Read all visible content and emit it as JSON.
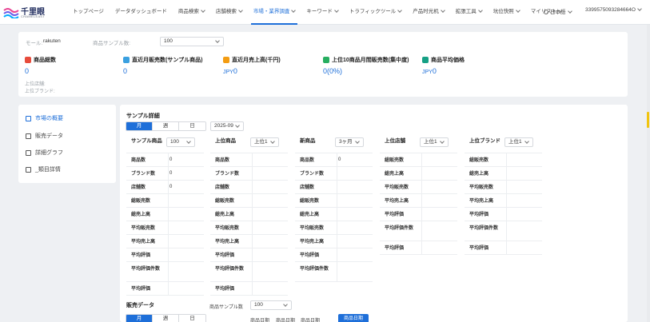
{
  "brand": {
    "name": "千里眼",
    "subtitle": "CHAMELEAST"
  },
  "nav": {
    "items": [
      {
        "label": "トップページ",
        "dropdown": false,
        "active": false
      },
      {
        "label": "データダッシュボード",
        "dropdown": false,
        "active": false
      },
      {
        "label": "商品検索",
        "dropdown": true,
        "active": false
      },
      {
        "label": "店舗検索",
        "dropdown": true,
        "active": false
      },
      {
        "label": "市場・業界調査",
        "dropdown": true,
        "active": true
      },
      {
        "label": "キーワード",
        "dropdown": true,
        "active": false
      },
      {
        "label": "トラフィックツール",
        "dropdown": true,
        "active": false
      },
      {
        "label": "产品时光机",
        "dropdown": true,
        "active": false
      },
      {
        "label": "拡張工具",
        "dropdown": true,
        "active": false
      },
      {
        "label": "坑位快照",
        "dropdown": true,
        "active": false
      },
      {
        "label": "マイリスト",
        "dropdown": true,
        "active": false
      }
    ],
    "language": "日本語",
    "user": "3399575093284664O"
  },
  "summary": {
    "mall_label": "モール:",
    "mall_value": "rakuten",
    "sample_label": "商品サンプル数:",
    "sample_value": "100",
    "metrics": [
      {
        "icon": "product-count-icon",
        "color": "#e74c3c",
        "title": "商品総数",
        "value": "0",
        "currency": ""
      },
      {
        "icon": "monthly-sales-icon",
        "color": "#3aa0e0",
        "title": "直近月販売数(サンプル商品)",
        "value": "0",
        "currency": ""
      },
      {
        "icon": "monthly-revenue-icon",
        "color": "#f39c12",
        "title": "直近月売上高(千円)",
        "value": "0",
        "currency": "JPY"
      },
      {
        "icon": "top10-share-icon",
        "color": "#27ae60",
        "title": "上位10商品月間販売数(集中度)",
        "value": "0(0%)",
        "currency": ""
      },
      {
        "icon": "average-price-icon",
        "color": "#16a085",
        "title": "商品平均価格",
        "value": "0",
        "currency": "JPY"
      }
    ],
    "top_shop_label": "上位店舗:",
    "top_brand_label": "上位ブランド:"
  },
  "sidebar": {
    "items": [
      {
        "label": "市場の概要",
        "icon": "market-overview-icon",
        "active": true
      },
      {
        "label": "販売データ",
        "icon": "sales-data-icon",
        "active": false
      },
      {
        "label": "詳細グラフ",
        "icon": "detail-graph-icon",
        "active": false
      },
      {
        "label": "_類目詳情",
        "icon": "category-detail-icon",
        "active": false
      }
    ]
  },
  "sample_detail": {
    "title": "サンプル詳細",
    "tabs": [
      "月",
      "週",
      "日"
    ],
    "active_tab": 0,
    "month_value": "2025-09",
    "groups": [
      {
        "header": "サンプル商品",
        "select": "100",
        "rows": [
          {
            "k": "商品数",
            "v": "0"
          },
          {
            "k": "ブランド数",
            "v": "0"
          },
          {
            "k": "店舗数",
            "v": "0"
          },
          {
            "k": "総販売数",
            "v": ""
          },
          {
            "k": "総売上高",
            "v": ""
          },
          {
            "k": "平均販売数",
            "v": ""
          },
          {
            "k": "平均売上高",
            "v": ""
          },
          {
            "k": "平均評価",
            "v": ""
          },
          {
            "k": "平均評価件数",
            "v": "",
            "tall": true
          },
          {
            "k": "平均評価",
            "v": ""
          }
        ]
      },
      {
        "header": "上位商品",
        "select": "上位1",
        "rows": [
          {
            "k": "商品数",
            "v": ""
          },
          {
            "k": "ブランド数",
            "v": ""
          },
          {
            "k": "店舗数",
            "v": ""
          },
          {
            "k": "総販売数",
            "v": ""
          },
          {
            "k": "総売上高",
            "v": ""
          },
          {
            "k": "平均販売数",
            "v": ""
          },
          {
            "k": "平均売上高",
            "v": ""
          },
          {
            "k": "平均評価",
            "v": ""
          },
          {
            "k": "平均評価件数",
            "v": "",
            "tall": true
          },
          {
            "k": "平均評価",
            "v": ""
          }
        ]
      },
      {
        "header": "新商品",
        "select": "3ヶ月",
        "rows": [
          {
            "k": "商品数",
            "v": "0"
          },
          {
            "k": "ブランド数",
            "v": ""
          },
          {
            "k": "店舗数",
            "v": ""
          },
          {
            "k": "総販売数",
            "v": ""
          },
          {
            "k": "総売上高",
            "v": ""
          },
          {
            "k": "平均販売数",
            "v": ""
          },
          {
            "k": "平均売上高",
            "v": ""
          },
          {
            "k": "平均評価",
            "v": ""
          },
          {
            "k": "平均評価件数",
            "v": "",
            "tall": true
          }
        ]
      },
      {
        "header": "上位店舗",
        "select": "上位1",
        "rows": [
          {
            "k": "総販売数",
            "v": ""
          },
          {
            "k": "総売上高",
            "v": ""
          },
          {
            "k": "平均販売数",
            "v": ""
          },
          {
            "k": "平均売上高",
            "v": ""
          },
          {
            "k": "平均評価",
            "v": ""
          },
          {
            "k": "平均評価件数",
            "v": "",
            "tall": true
          },
          {
            "k": "平均評価",
            "v": ""
          }
        ]
      },
      {
        "header": "上位ブランド",
        "select": "上位1",
        "rows": [
          {
            "k": "総販売数",
            "v": ""
          },
          {
            "k": "総売上高",
            "v": ""
          },
          {
            "k": "平均販売数",
            "v": ""
          },
          {
            "k": "平均売上高",
            "v": ""
          },
          {
            "k": "平均評価",
            "v": ""
          },
          {
            "k": "平均評価件数",
            "v": "",
            "tall": true
          },
          {
            "k": "平均評価",
            "v": ""
          }
        ]
      }
    ]
  },
  "sales_data": {
    "title": "販売データ",
    "sample_label": "商品サンプル数",
    "sample_value": "100",
    "tabs": [
      "月",
      "週",
      "日"
    ],
    "active_tab": 0,
    "columns": [
      "商品日期",
      "商品日期",
      "商品日期",
      "商品日期"
    ]
  }
}
